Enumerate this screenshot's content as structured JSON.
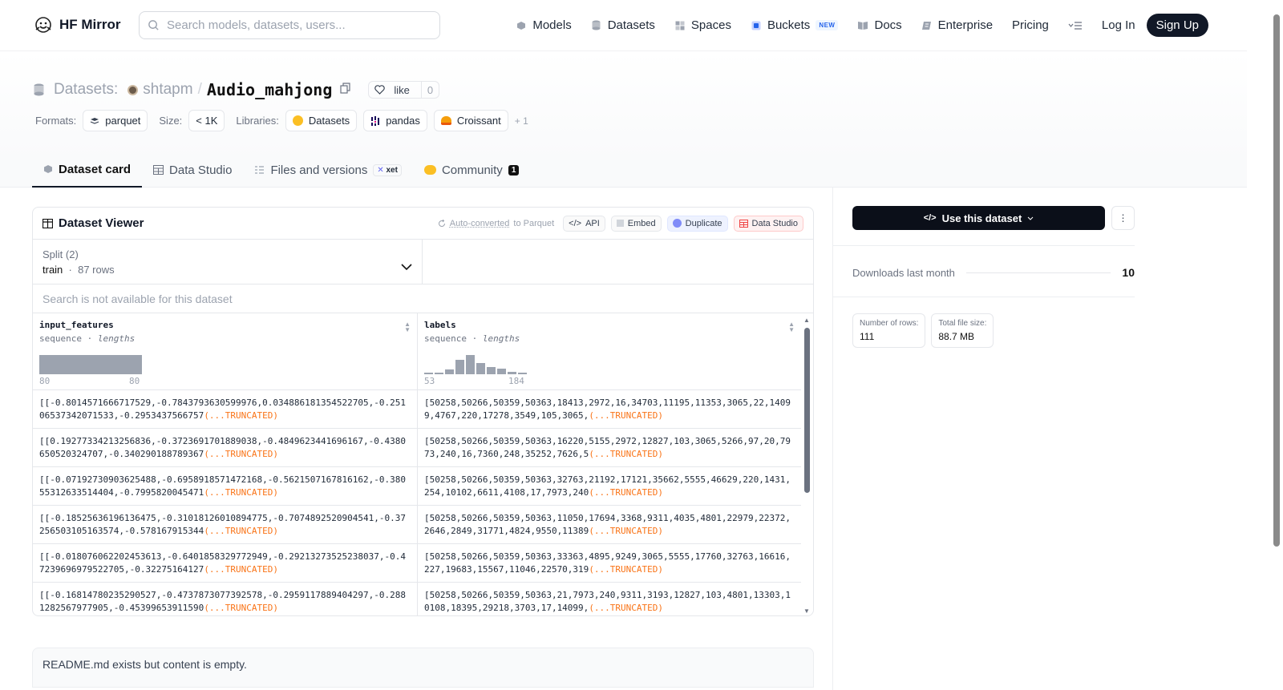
{
  "nav": {
    "brand": "HF Mirror",
    "search_placeholder": "Search models, datasets, users...",
    "items": [
      {
        "label": "Models",
        "icon": "models-icon"
      },
      {
        "label": "Datasets",
        "icon": "datasets-icon"
      },
      {
        "label": "Spaces",
        "icon": "spaces-icon"
      },
      {
        "label": "Buckets",
        "icon": "buckets-icon",
        "badge": "NEW"
      },
      {
        "label": "Docs",
        "icon": "docs-icon"
      },
      {
        "label": "Enterprise",
        "icon": "enterprise-icon"
      },
      {
        "label": "Pricing"
      }
    ],
    "login": "Log In",
    "signup": "Sign Up"
  },
  "header": {
    "kind": "Datasets:",
    "owner": "shtapm",
    "separator": "/",
    "repo": "Audio_mahjong",
    "like_label": "like",
    "like_count": "0",
    "formats_label": "Formats:",
    "format": "parquet",
    "size_label": "Size:",
    "size": "< 1K",
    "libraries_label": "Libraries:",
    "libraries": [
      "Datasets",
      "pandas",
      "Croissant"
    ],
    "more_libraries": "+ 1"
  },
  "tabs": {
    "dataset_card": "Dataset card",
    "data_studio": "Data Studio",
    "files": "Files and versions",
    "xet": "xet",
    "community": "Community",
    "community_count": "1"
  },
  "viewer": {
    "title": "Dataset Viewer",
    "auto_converted": "Auto-converted",
    "to_parquet": "to Parquet",
    "api": "API",
    "embed": "Embed",
    "duplicate": "Duplicate",
    "data_studio": "Data Studio",
    "split_label": "Split (2)",
    "split_value": "train",
    "split_rows": "87 rows",
    "search_na": "Search is not available for this dataset",
    "columns": [
      {
        "name": "input_features",
        "type": "sequence",
        "sub": "lengths",
        "min": "80",
        "max": "80"
      },
      {
        "name": "labels",
        "type": "sequence",
        "sub": "lengths",
        "min": "53",
        "max": "184"
      }
    ],
    "truncated": "(...TRUNCATED)",
    "rows": [
      {
        "a": "[[-0.8014571666717529,-0.7843793630599976,0.034886181354522705,-0.25106537342071533,-0.2953437566757",
        "b": "[50258,50266,50359,50363,18413,2972,16,34703,11195,11353,3065,22,14099,4767,220,17278,3549,105,3065,"
      },
      {
        "a": "[[0.19277334213256836,-0.3723691701889038,-0.4849623441696167,-0.4380650520324707,-0.340290188789367",
        "b": "[50258,50266,50359,50363,16220,5155,2972,12827,103,3065,5266,97,20,7973,240,16,7360,248,35252,7626,5"
      },
      {
        "a": "[[-0.07192730903625488,-0.6958918571472168,-0.5621507167816162,-0.38055312633514404,-0.7995820045471",
        "b": "[50258,50266,50359,50363,32763,21192,17121,35662,5555,46629,220,1431,254,10102,6611,4108,17,7973,240"
      },
      {
        "a": "[[-0.18525636196136475,-0.31018126010894775,-0.7074892520904541,-0.37256503105163574,-0.578167915344",
        "b": "[50258,50266,50359,50363,11050,17694,3368,9311,4035,4801,22979,22372,2646,2849,31771,4824,9550,11389"
      },
      {
        "a": "[[-0.018076062202453613,-0.6401858329772949,-0.29213273525238037,-0.47239696979522705,-0.32275164127",
        "b": "[50258,50266,50359,50363,33363,4895,9249,3065,5555,17760,32763,16616,227,19683,15567,11046,22570,319"
      },
      {
        "a": "[[-0.16814780235290527,-0.4737873077392578,-0.2959117889404297,-0.2881282567977905,-0.45399653911590",
        "b": "[50258,50266,50359,50363,21,7973,240,9311,3193,12827,103,4801,13303,10108,18395,29218,3703,17,14099,"
      }
    ],
    "readme": "README.md exists but content is empty."
  },
  "sidebar": {
    "use_dataset": "Use this dataset",
    "downloads_label": "Downloads last month",
    "downloads_value": "10",
    "rows_label": "Number of rows:",
    "rows_value": "111",
    "size_label": "Total file size:",
    "size_value": "88.7 MB"
  }
}
